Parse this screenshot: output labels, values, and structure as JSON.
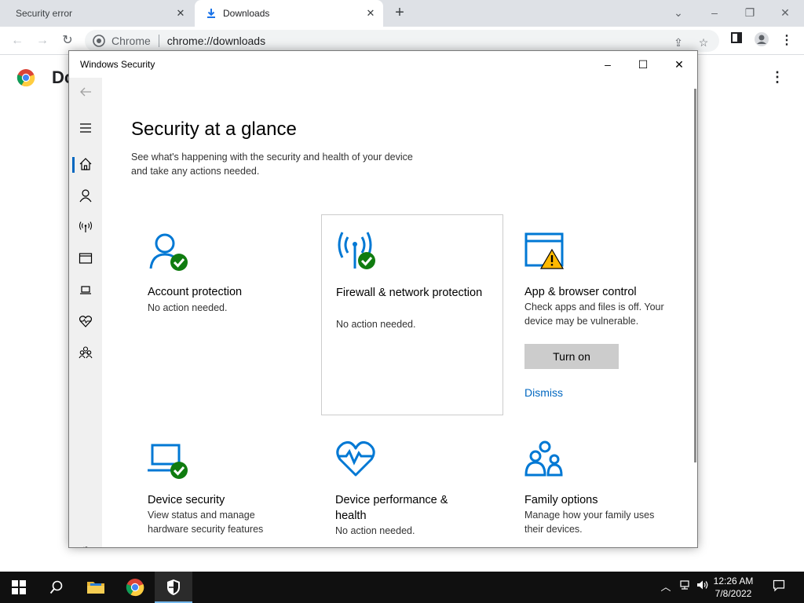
{
  "browser": {
    "tabs": [
      {
        "label": "Security error"
      },
      {
        "label": "Downloads"
      }
    ],
    "omnibox": {
      "chip": "Chrome",
      "url": "chrome://downloads"
    },
    "page_title": "Do"
  },
  "ws": {
    "window_title": "Windows Security",
    "heading": "Security at a glance",
    "subheading": "See what's happening with the security and health of your device and take any actions needed.",
    "tiles": [
      {
        "title": "Account protection",
        "status": "No action needed."
      },
      {
        "title": "Firewall & network protection",
        "status": "No action needed."
      },
      {
        "title": "App & browser control",
        "status": "Check apps and files is off. Your device may be vulnerable.",
        "button": "Turn on",
        "link": "Dismiss"
      },
      {
        "title": "Device security",
        "status": "View status and manage hardware security features"
      },
      {
        "title": "Device performance & health",
        "status": "No action needed."
      },
      {
        "title": "Family options",
        "status": "Manage how your family uses their devices."
      }
    ]
  },
  "taskbar": {
    "time": "12:26 AM",
    "date": "7/8/2022"
  },
  "colors": {
    "accent_blue": "#0067c0",
    "icon_blue": "#0078d4",
    "ok_green": "#107c10",
    "warning_yellow": "#ffb900"
  }
}
